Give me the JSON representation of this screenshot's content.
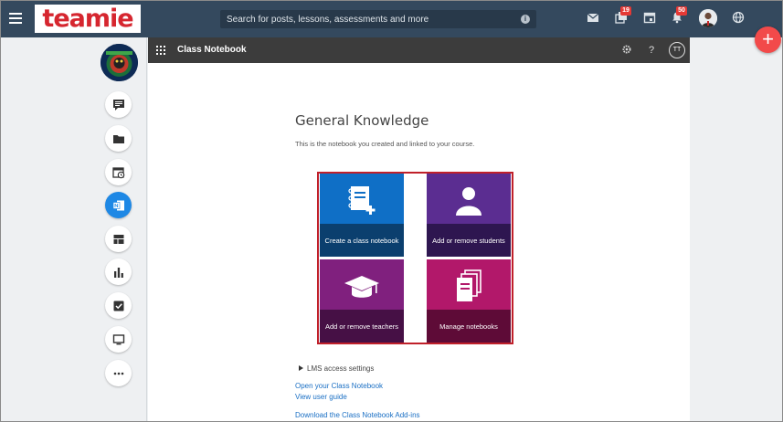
{
  "logo": {
    "text": "teamie"
  },
  "search": {
    "placeholder": "Search for posts, lessons, assessments and more"
  },
  "topbar": {
    "badges": {
      "lessons": "19",
      "notifications": "50"
    }
  },
  "fab": {
    "label": "+"
  },
  "header": {
    "title": "Class Notebook",
    "avatar_initials": "TT"
  },
  "notebook": {
    "title": "General Knowledge",
    "description": "This is the notebook you created and linked to your course."
  },
  "tiles": [
    {
      "label": "Create a class notebook",
      "color": "#0f6fc6"
    },
    {
      "label": "Add or remove students",
      "color": "#5b2d91"
    },
    {
      "label": "Add or remove teachers",
      "color": "#80207e"
    },
    {
      "label": "Manage notebooks",
      "color": "#b2186a"
    }
  ],
  "links": {
    "lms_settings": "LMS access settings",
    "open_notebook": "Open your Class Notebook",
    "user_guide": "View user guide",
    "download_addins": "Download the Class Notebook Add-ins"
  },
  "colors": {
    "topbar": "#34495e",
    "accent": "#1e88e5",
    "highlight_border": "#c0202a",
    "fab": "#f24a4a"
  }
}
